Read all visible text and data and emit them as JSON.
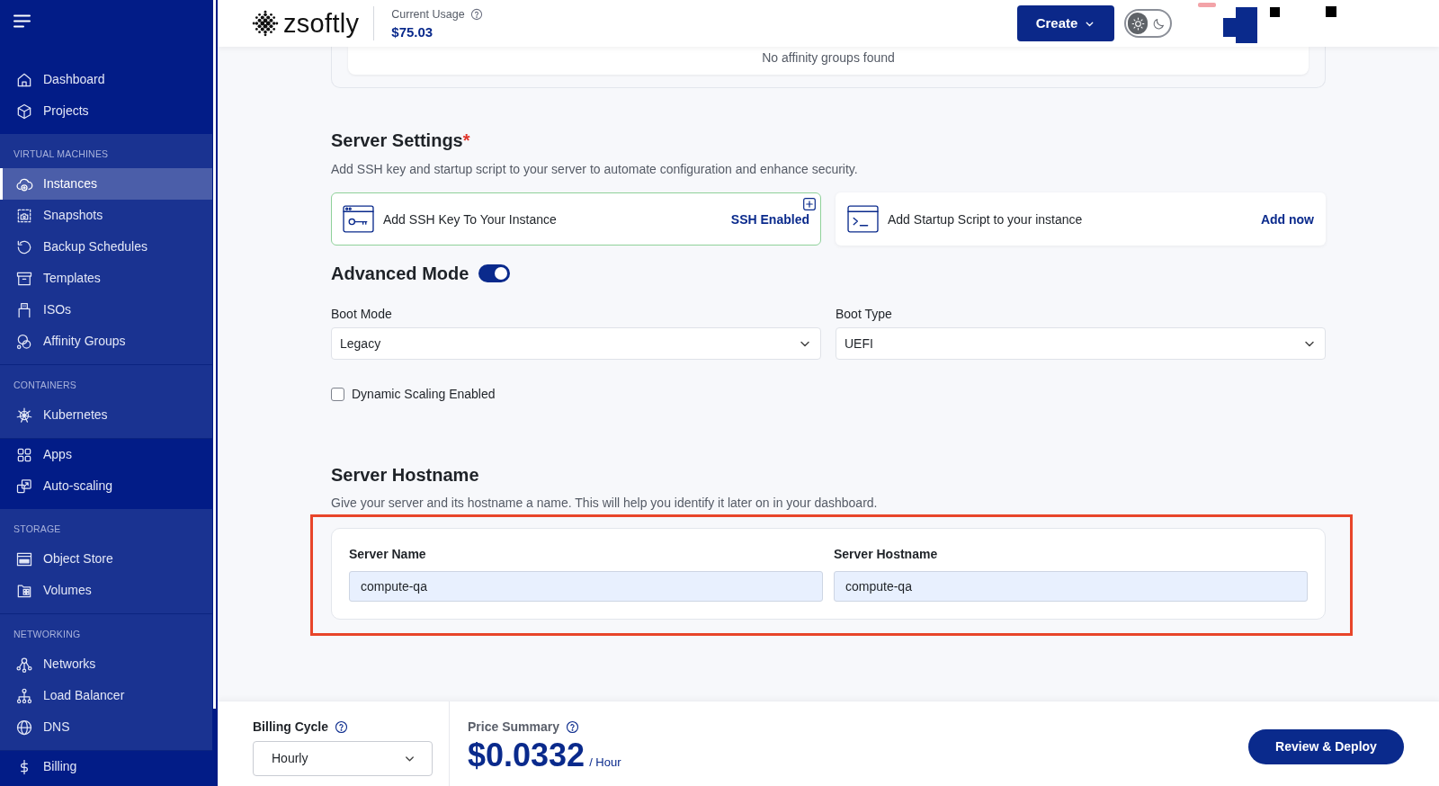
{
  "sidebar": {
    "groups": [
      {
        "kind": "plain",
        "items": [
          {
            "label": "Dashboard",
            "selected": false
          },
          {
            "label": "Projects",
            "selected": false
          }
        ]
      },
      {
        "kind": "section",
        "heading": "VIRTUAL MACHINES",
        "items": [
          {
            "label": "Instances",
            "selected": true
          },
          {
            "label": "Snapshots",
            "selected": false
          },
          {
            "label": "Backup Schedules",
            "selected": false
          },
          {
            "label": "Templates",
            "selected": false
          },
          {
            "label": "ISOs",
            "selected": false
          },
          {
            "label": "Affinity Groups",
            "selected": false
          }
        ]
      },
      {
        "kind": "section",
        "heading": "CONTAINERS",
        "items": [
          {
            "label": "Kubernetes",
            "selected": false
          }
        ]
      },
      {
        "kind": "plain",
        "items": [
          {
            "label": "Apps",
            "selected": false
          },
          {
            "label": "Auto-scaling",
            "selected": false
          }
        ]
      },
      {
        "kind": "section",
        "heading": "STORAGE",
        "items": [
          {
            "label": "Object Store",
            "selected": false
          },
          {
            "label": "Volumes",
            "selected": false
          }
        ]
      },
      {
        "kind": "section",
        "heading": "NETWORKING",
        "items": [
          {
            "label": "Networks",
            "selected": false
          },
          {
            "label": "Load Balancer",
            "selected": false
          },
          {
            "label": "DNS",
            "selected": false
          }
        ]
      },
      {
        "kind": "plain",
        "items": [
          {
            "label": "Billing",
            "selected": false
          }
        ]
      }
    ]
  },
  "header": {
    "logo": "zsoftly",
    "usage_label": "Current Usage",
    "usage_value": "$75.03",
    "create_button": "Create",
    "theme_toggle": [
      {
        "kind": "sun",
        "selected": true
      },
      {
        "kind": "moon",
        "selected": false
      }
    ]
  },
  "affinity_groups": {
    "empty_text": "No affinity groups found"
  },
  "server_settings": {
    "title": "Server Settings",
    "required_mark": "*",
    "description": "Add SSH key and startup script to your server to automate configuration and enhance security.",
    "cards": [
      {
        "kind": "ssh",
        "label": "Add SSH Key To Your Instance",
        "action": "SSH Enabled",
        "active": true
      },
      {
        "kind": "script",
        "label": "Add Startup Script to your instance",
        "action": "Add now",
        "active": false
      }
    ]
  },
  "advanced_mode": {
    "label": "Advanced Mode",
    "on": true
  },
  "boot_fields": [
    {
      "label": "Boot Mode",
      "value": "Legacy"
    },
    {
      "label": "Boot Type",
      "value": "UEFI"
    }
  ],
  "dynamic_scaling": {
    "label": "Dynamic Scaling Enabled",
    "checked": false
  },
  "server_hostname": {
    "title": "Server Hostname",
    "description": "Give your server and its hostname a name. This will help you identify it later on in your dashboard.",
    "highlighted": true,
    "fields": [
      {
        "label": "Server Name",
        "value": "compute-qa"
      },
      {
        "label": "Server Hostname",
        "value": "compute-qa"
      }
    ]
  },
  "footer": {
    "billing_cycle": {
      "label": "Billing Cycle",
      "value": "Hourly"
    },
    "price_summary": {
      "label": "Price Summary",
      "amount": "$0.0332",
      "unit": "/ Hour"
    },
    "deploy_button": "Review & Deploy"
  }
}
